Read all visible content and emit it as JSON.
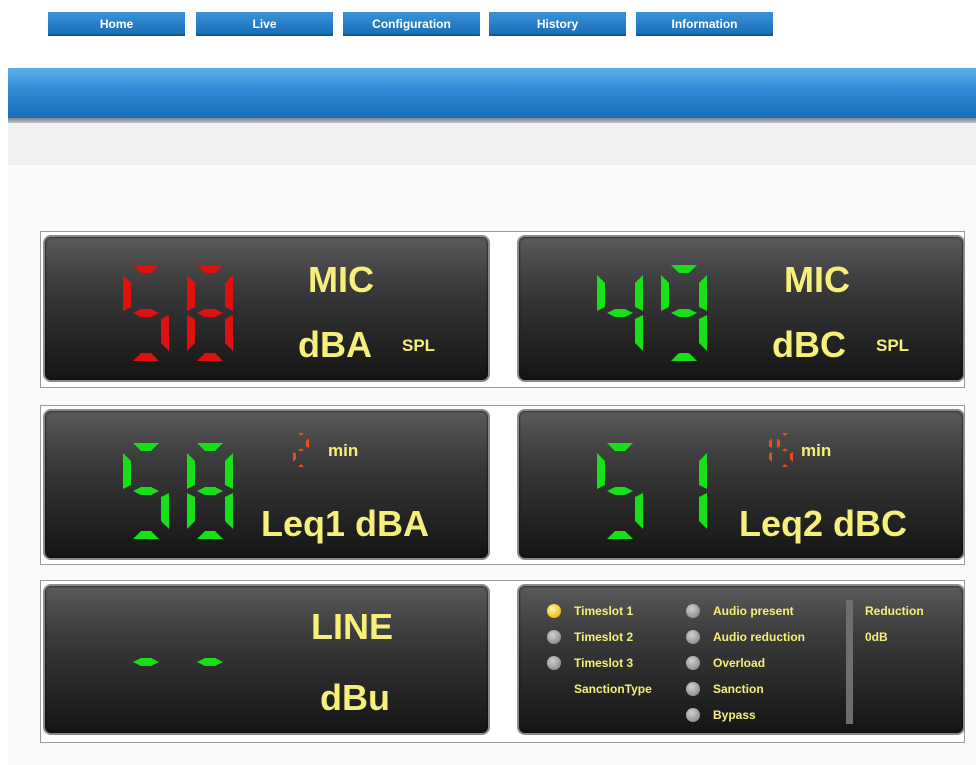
{
  "nav": {
    "home": "Home",
    "live": "Live",
    "configuration": "Configuration",
    "history": "History",
    "information": "Information"
  },
  "colors": {
    "nav_blue": "#1a6fb8",
    "label_yellow": "#f6f07a",
    "digit_red": "#e01010",
    "digit_green": "#18e018",
    "minute_orange": "#e84d1b",
    "indicator_active": "#f2c21b"
  },
  "meters": {
    "mic_dba": {
      "value": "58",
      "color": "red",
      "source": "MIC",
      "unit": "dBA",
      "suffix": "SPL"
    },
    "mic_dbc": {
      "value": "49",
      "color": "green",
      "source": "MIC",
      "unit": "dBC",
      "suffix": "SPL"
    },
    "leq1": {
      "value": "58",
      "minutes": "2",
      "min_label": "min",
      "label": "Leq1 dBA"
    },
    "leq2": {
      "value": "51",
      "minutes": "15",
      "min_label": "min",
      "label": "Leq2 dBC"
    },
    "line": {
      "value": "--",
      "source": "LINE",
      "unit": "dBu"
    }
  },
  "status": {
    "timeslots": [
      {
        "label": "Timeslot 1",
        "active": true
      },
      {
        "label": "Timeslot 2",
        "active": false
      },
      {
        "label": "Timeslot 3",
        "active": false
      }
    ],
    "sanction_type_label": "SanctionType",
    "flags": [
      {
        "label": "Audio present",
        "active": false
      },
      {
        "label": "Audio reduction",
        "active": false
      },
      {
        "label": "Overload",
        "active": false
      },
      {
        "label": "Sanction",
        "active": false
      },
      {
        "label": "Bypass",
        "active": false
      }
    ],
    "reduction_label": "Reduction",
    "reduction_value": "0dB"
  }
}
